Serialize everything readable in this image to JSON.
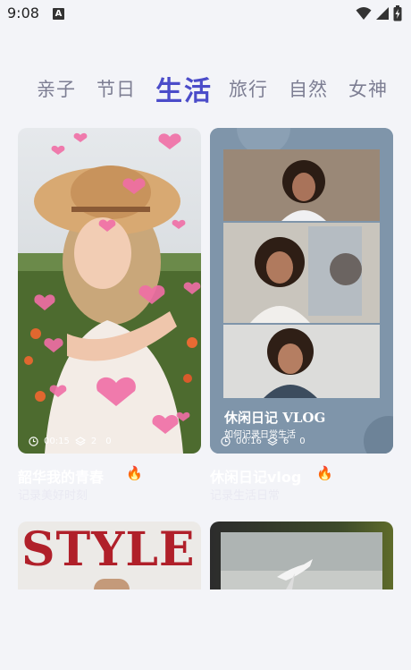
{
  "status": {
    "time": "9:08",
    "notification_badge": "A"
  },
  "tabs": [
    {
      "label": "亲子"
    },
    {
      "label": "节日"
    },
    {
      "label": "生活"
    },
    {
      "label": "旅行"
    },
    {
      "label": "自然"
    },
    {
      "label": "女神"
    }
  ],
  "cards": [
    {
      "duration": "00:15",
      "layers": "2",
      "count": "0",
      "title": "韶华我的青春",
      "subtitle": "记录美好时刻"
    },
    {
      "overlay_title": "休闲日记 VLOG",
      "overlay_subtitle": "如何记录日常生活",
      "duration": "00:16",
      "layers": "6",
      "count": "0",
      "title": "休闲日记vlog",
      "subtitle": "记录生活日常"
    },
    {
      "headline": "STYLE"
    },
    {}
  ],
  "colors": {
    "active_tab": "#4b4cc9",
    "inactive_tab": "#7d7e93",
    "background": "#f3f4f8",
    "card2_bg": "#7d93a8",
    "heart": "#f06ea6",
    "style_red": "#b0202a"
  }
}
